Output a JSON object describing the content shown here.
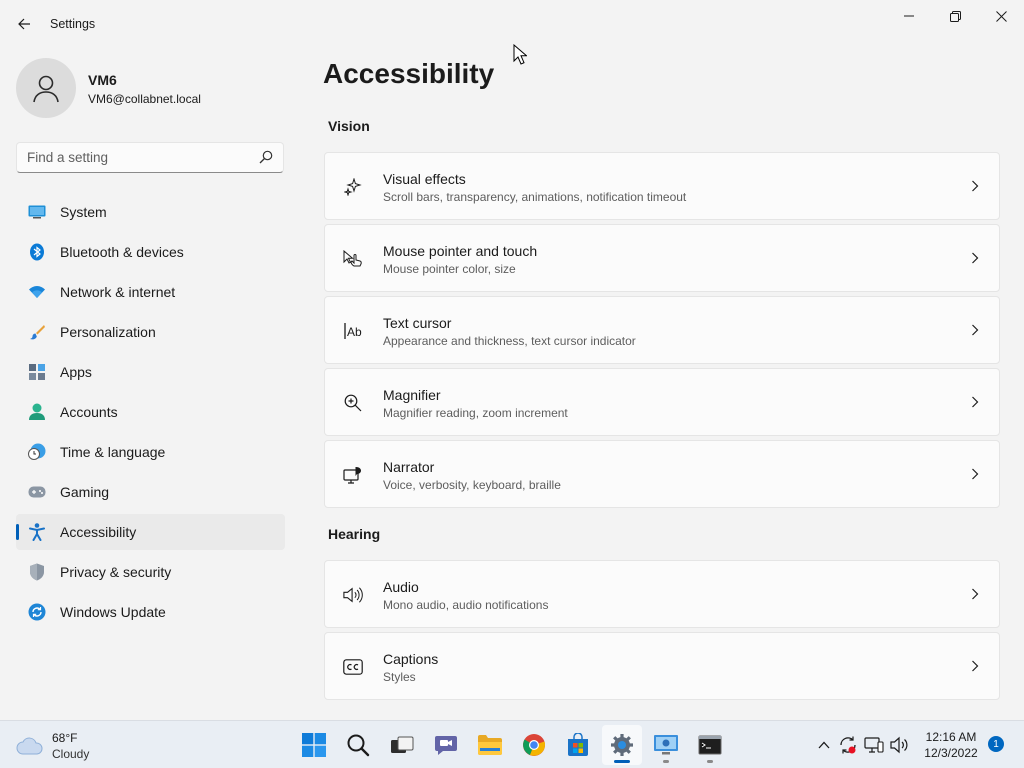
{
  "window": {
    "title": "Settings"
  },
  "user": {
    "name": "VM6",
    "email": "VM6@collabnet.local"
  },
  "search": {
    "placeholder": "Find a setting"
  },
  "nav": [
    {
      "label": "System",
      "icon": "monitor-icon"
    },
    {
      "label": "Bluetooth & devices",
      "icon": "bluetooth-icon"
    },
    {
      "label": "Network & internet",
      "icon": "wifi-icon"
    },
    {
      "label": "Personalization",
      "icon": "brush-icon"
    },
    {
      "label": "Apps",
      "icon": "apps-icon"
    },
    {
      "label": "Accounts",
      "icon": "person-icon"
    },
    {
      "label": "Time & language",
      "icon": "clock-globe-icon"
    },
    {
      "label": "Gaming",
      "icon": "gamepad-icon"
    },
    {
      "label": "Accessibility",
      "icon": "accessibility-icon",
      "active": true
    },
    {
      "label": "Privacy & security",
      "icon": "shield-icon"
    },
    {
      "label": "Windows Update",
      "icon": "update-icon"
    }
  ],
  "page": {
    "title": "Accessibility"
  },
  "sections": {
    "vision": "Vision",
    "hearing": "Hearing"
  },
  "cards": [
    {
      "title": "Visual effects",
      "subtitle": "Scroll bars, transparency, animations, notification timeout",
      "icon": "sparkle-icon"
    },
    {
      "title": "Mouse pointer and touch",
      "subtitle": "Mouse pointer color, size",
      "icon": "pointer-touch-icon"
    },
    {
      "title": "Text cursor",
      "subtitle": "Appearance and thickness, text cursor indicator",
      "icon": "text-cursor-icon"
    },
    {
      "title": "Magnifier",
      "subtitle": "Magnifier reading, zoom increment",
      "icon": "magnifier-icon"
    },
    {
      "title": "Narrator",
      "subtitle": "Voice, verbosity, keyboard, braille",
      "icon": "narrator-icon"
    },
    {
      "title": "Audio",
      "subtitle": "Mono audio, audio notifications",
      "icon": "speaker-icon"
    },
    {
      "title": "Captions",
      "subtitle": "Styles",
      "icon": "captions-icon"
    }
  ],
  "taskbar": {
    "weather": {
      "temp": "68°F",
      "desc": "Cloudy"
    },
    "clock": {
      "time": "12:16 AM",
      "date": "12/3/2022"
    },
    "notifications": "1"
  },
  "colors": {
    "accent": "#005fb8",
    "background": "#f3f3f3",
    "card": "#fbfbfb"
  }
}
